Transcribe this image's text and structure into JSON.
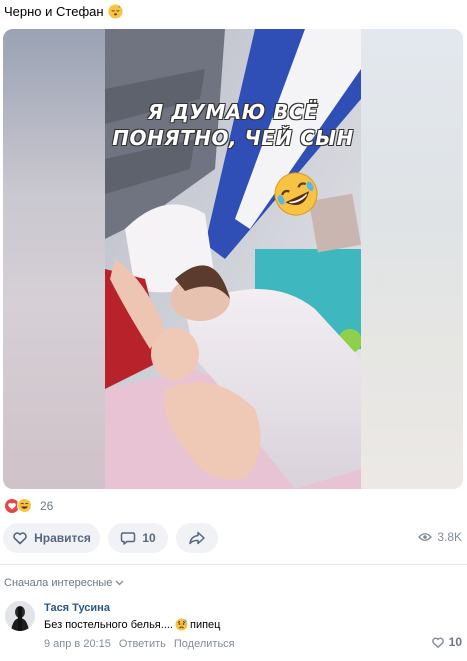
{
  "post": {
    "text": "Черно и Стефан",
    "text_emoji": "sleeping-face-icon"
  },
  "media": {
    "caption_line1": "Я ДУМАЮ ВСЁ",
    "caption_line2": "ПОНЯТНО, ЧЕЙ СЫН",
    "caption_emoji": "rolling-on-floor-laughing-icon"
  },
  "reactions": {
    "icons": [
      "heart-icon",
      "laughing-face-icon"
    ],
    "count": "26"
  },
  "actions": {
    "like_label": "Нравится",
    "comment_count": "10",
    "views": "3.8K"
  },
  "comments": {
    "sort_label": "Сначала интересные",
    "items": [
      {
        "author": "Тася Тусина",
        "text": "Без постельного белья....",
        "text_suffix": "пипец",
        "time": "9 апр в 20:15",
        "reply_label": "Ответить",
        "share_label": "Поделиться",
        "likes": "10"
      }
    ]
  },
  "colors": {
    "link": "#2a5885",
    "secondary_text": "#818c99",
    "button_bg": "#f0f2f5",
    "heart": "#e64646"
  }
}
